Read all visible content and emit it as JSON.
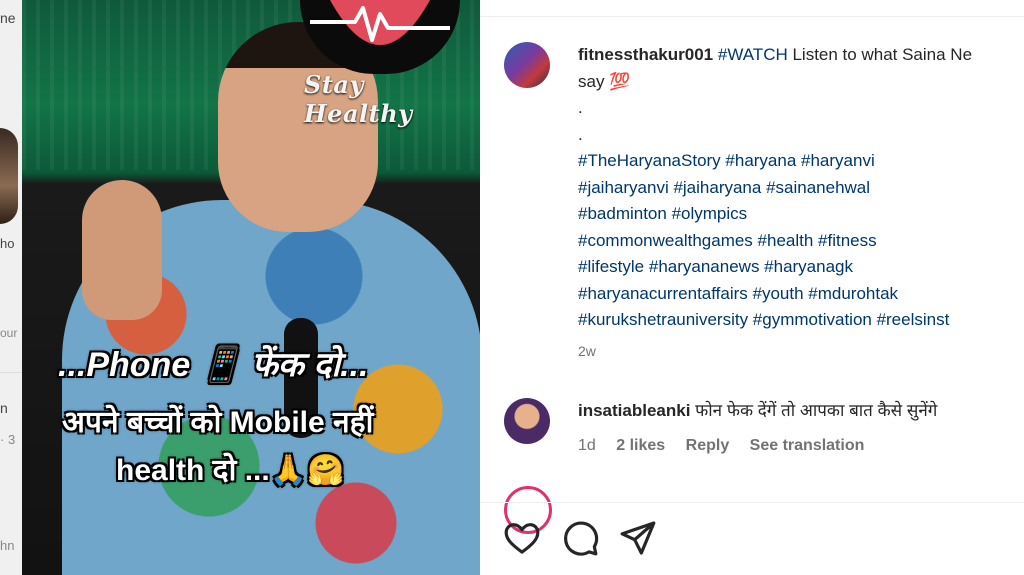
{
  "background": {
    "fragments": [
      "ne",
      "ho",
      "our",
      "n",
      "· 3",
      "hn"
    ]
  },
  "video": {
    "logo_text": "Stay Healthy",
    "caption_line1": "...Phone 📱 फेंक दो...",
    "caption_line2": "अपने बच्चों को Mobile नहीं",
    "caption_line3": "health दो ...🙏🤗"
  },
  "post": {
    "username": "fitnessthakur001",
    "lines": [
      {
        "tag": "#WATCH",
        "text": " Listen to what Saina Ne"
      },
      {
        "text": "say 💯"
      },
      {
        "text": "."
      },
      {
        "text": "."
      },
      {
        "text": "#TheHaryanaStory #haryana #haryanvi"
      },
      {
        "text": "#jaiharyanvi #jaiharyana #sainanehwal"
      },
      {
        "text": "#badminton #olympics"
      },
      {
        "text": "#commonwealthgames #health #fitness"
      },
      {
        "text": "#lifestyle #haryananews #haryanagk"
      },
      {
        "text": "#haryanacurrentaffairs #youth #mdurohtak"
      },
      {
        "text": "#kurukshetrauniversity #gymmotivation #reelsinst"
      }
    ],
    "time": "2w"
  },
  "comment": {
    "username": "insatiableanki",
    "text": "फोन फेक देंगें तो आपका बात कैसे सुनेंगे",
    "time": "1d",
    "likes": "2 likes",
    "reply": "Reply",
    "translation": "See translation"
  },
  "actions": {
    "icons": [
      "heart-icon",
      "comment-icon",
      "share-icon"
    ]
  },
  "colors": {
    "link": "#00376b",
    "muted": "#737373",
    "story_ring": "#e1306c"
  }
}
